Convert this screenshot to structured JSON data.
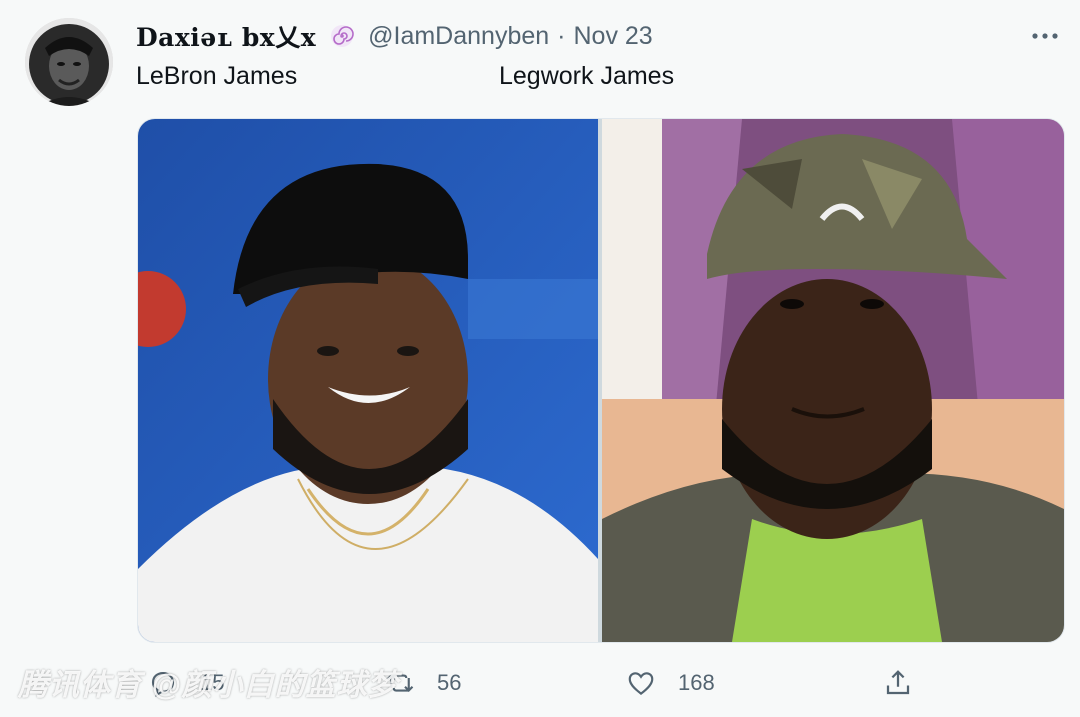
{
  "tweet": {
    "display_name": "Daxiəʟ bx乂x",
    "handle": "@IamDannyben",
    "separator": "·",
    "date": "Nov 23",
    "text_left": "LeBron James",
    "text_right": "Legwork James"
  },
  "actions": {
    "reply_count": "15",
    "retweet_count": "56",
    "like_count": "168"
  },
  "watermark": "腾讯体育 @颜小白的篮球梦",
  "colors": {
    "background": "#f7f9f9",
    "secondary_text": "#536471",
    "badge": "#b56cc9"
  }
}
